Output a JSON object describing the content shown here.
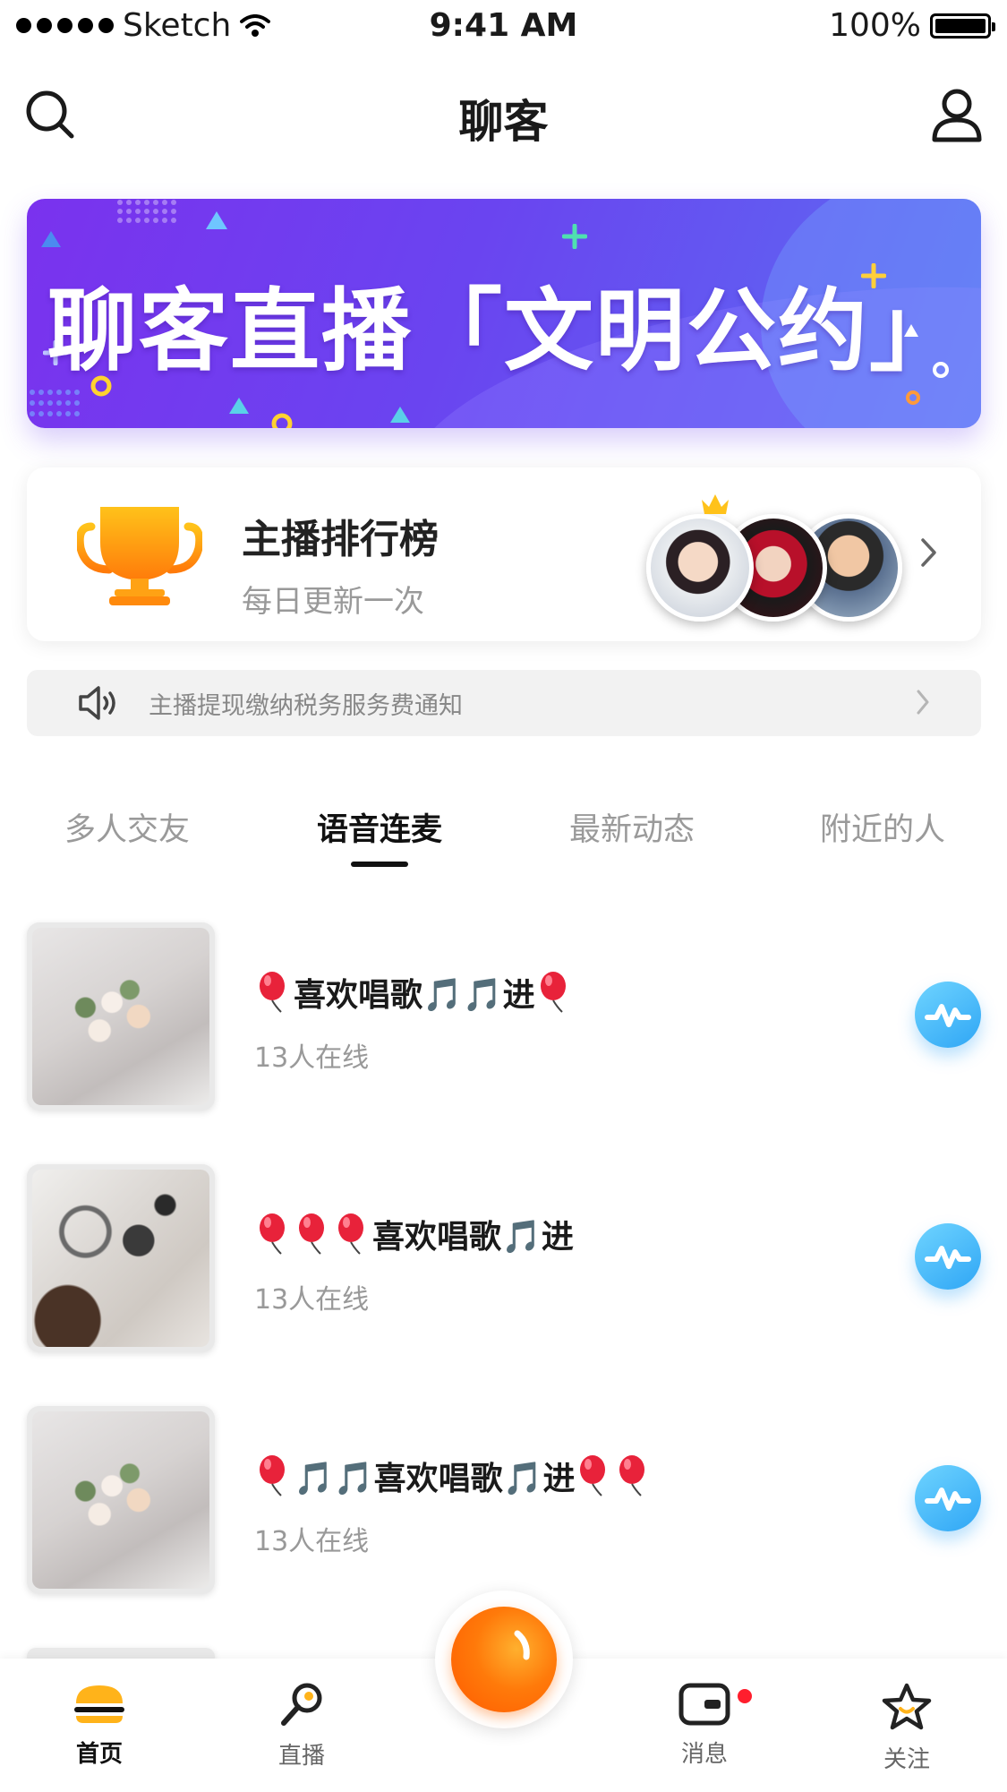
{
  "status_bar": {
    "carrier": "Sketch",
    "time": "9:41 AM",
    "battery": "100%"
  },
  "nav": {
    "title": "聊客"
  },
  "banner": {
    "headline": "聊客直播「文明公约」"
  },
  "ranking": {
    "title": "主播排行榜",
    "subtitle": "每日更新一次"
  },
  "notice": {
    "text": "主播提现缴纳税务服务费通知"
  },
  "tabs": [
    {
      "label": "多人交友"
    },
    {
      "label": "语音连麦"
    },
    {
      "label": "最新动态"
    },
    {
      "label": "附近的人"
    }
  ],
  "rooms": [
    {
      "title": "喜欢唱歌🎵🎵进",
      "online": "13人在线"
    },
    {
      "title": "喜欢唱歌🎵进",
      "online": "13人在线"
    },
    {
      "title": "🎵🎵喜欢唱歌🎵进",
      "online": "13人在线"
    }
  ],
  "tabbar": {
    "home": "首页",
    "live": "直播",
    "messages": "消息",
    "follow": "关注"
  },
  "colors": {
    "accent_orange": "#ff7a0a",
    "banner_purple": "#7a32ee",
    "voice_blue": "#2fa6f5",
    "badge_red": "#ff1e2d"
  }
}
